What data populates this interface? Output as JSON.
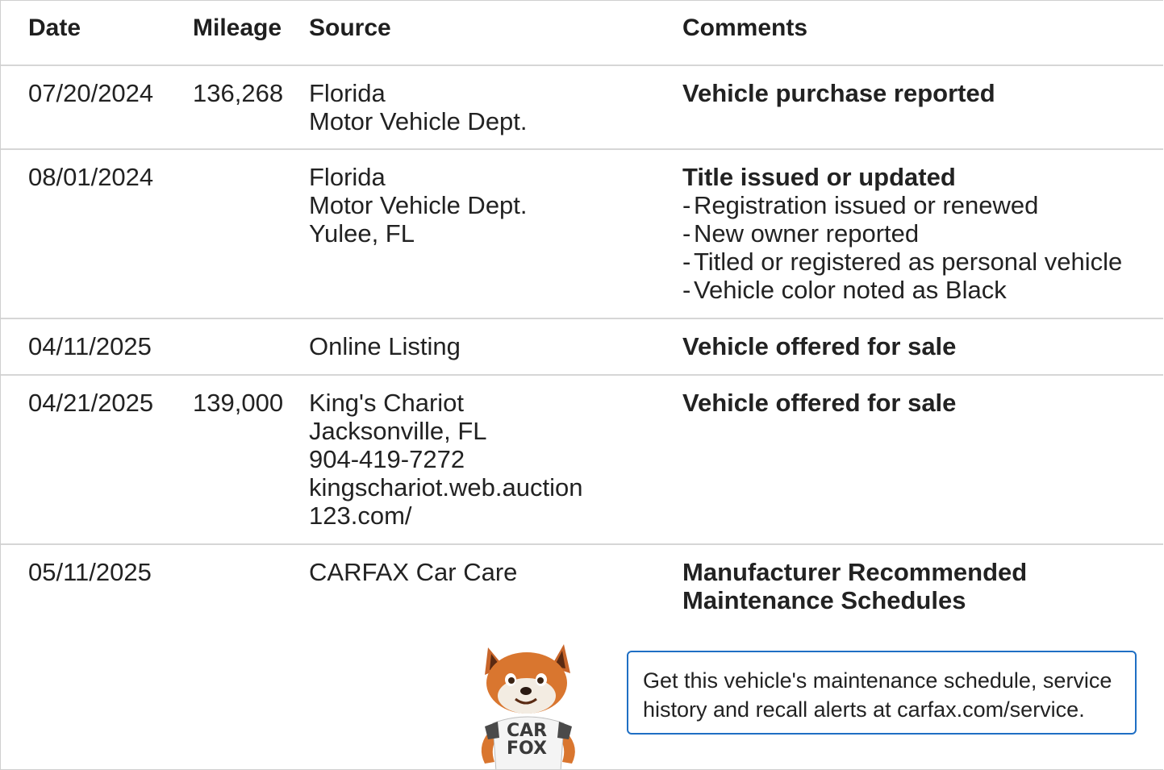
{
  "headers": {
    "date": "Date",
    "mileage": "Mileage",
    "source": "Source",
    "comments": "Comments"
  },
  "rows": [
    {
      "date": "07/20/2024",
      "mileage": "136,268",
      "source": [
        "Florida",
        "Motor Vehicle Dept."
      ],
      "comment_title": "Vehicle purchase reported",
      "comment_items": []
    },
    {
      "date": "08/01/2024",
      "mileage": "",
      "source": [
        "Florida",
        "Motor Vehicle Dept.",
        "Yulee, FL"
      ],
      "comment_title": "Title issued or updated",
      "comment_items": [
        "Registration issued or renewed",
        "New owner reported",
        "Titled or registered as personal vehicle",
        "Vehicle color noted as Black"
      ]
    },
    {
      "date": "04/11/2025",
      "mileage": "",
      "source": [
        "Online Listing"
      ],
      "comment_title": "Vehicle offered for sale",
      "comment_items": []
    },
    {
      "date": "04/21/2025",
      "mileage": "139,000",
      "source": [
        "King's Chariot",
        "Jacksonville, FL",
        "904-419-7272",
        "kingschariot.web.auction",
        "123.com/"
      ],
      "comment_title": "Vehicle offered for sale",
      "comment_items": []
    },
    {
      "date": "05/11/2025",
      "mileage": "",
      "source": [
        "CARFAX Car Care"
      ],
      "comment_title": [
        "Manufacturer Recommended",
        "Maintenance Schedules"
      ],
      "comment_items": []
    }
  ],
  "promo": {
    "line1": "Get this vehicle's maintenance schedule, service",
    "line2": "history and recall alerts at carfax.com/service.",
    "mascot_shirt": [
      "CAR",
      "FOX"
    ]
  },
  "colors": {
    "promo_border": "#1f6fc4",
    "divider": "#d6d6d6"
  }
}
